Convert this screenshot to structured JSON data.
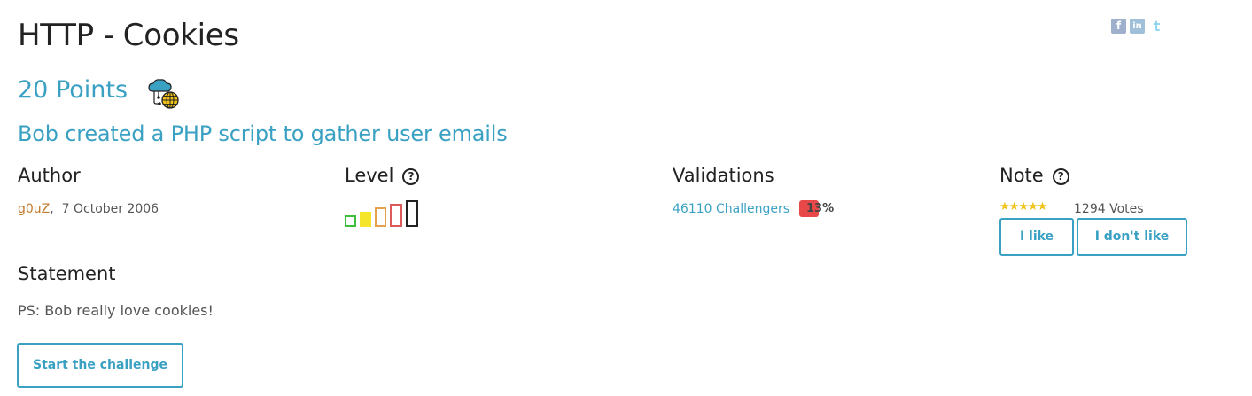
{
  "challenge": {
    "title": "HTTP - Cookies",
    "points": "20 Points",
    "subtitle": "Bob created a PHP script to gather user emails"
  },
  "author": {
    "heading": "Author",
    "name": "g0uZ",
    "separator": ",",
    "date": "7 October 2006"
  },
  "level": {
    "heading": "Level",
    "help": "?",
    "current": 2,
    "max": 5
  },
  "validations": {
    "heading": "Validations",
    "challengers": "46110 Challengers",
    "percent": "13%"
  },
  "note": {
    "heading": "Note",
    "help": "?",
    "stars": "★★★★★",
    "rating": 5,
    "votes": "1294 Votes",
    "like_label": "I like",
    "dislike_label": "I don't like"
  },
  "statement": {
    "heading": "Statement",
    "text": "PS: Bob really love cookies!"
  },
  "start_button": "Start the challenge",
  "social": [
    {
      "name": "facebook-icon",
      "glyph": "f"
    },
    {
      "name": "linkedin-icon",
      "glyph": "in"
    },
    {
      "name": "twitter-icon",
      "glyph": "t"
    }
  ],
  "colors": {
    "accent": "#3aa1c3",
    "author_link": "#c0792a",
    "badge": "#e94848",
    "star": "#f1c21a",
    "level": [
      "#3cbf3c",
      "#f5e52a",
      "#e6a14c",
      "#dd5a5a",
      "#222222"
    ]
  }
}
